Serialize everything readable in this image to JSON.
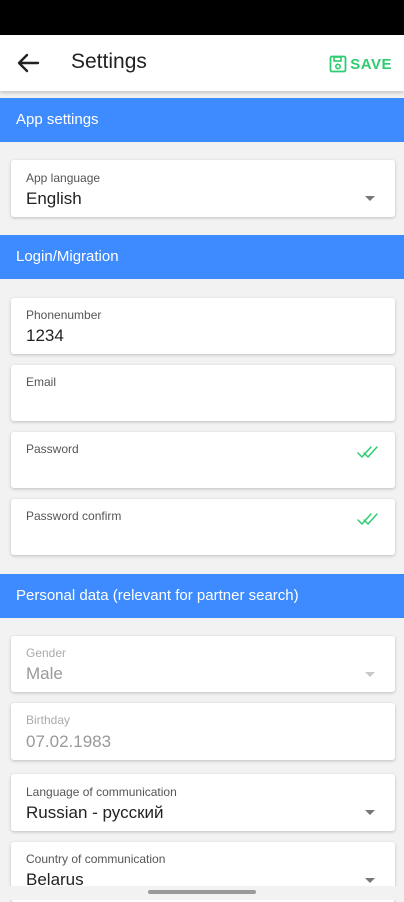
{
  "appbar": {
    "title": "Settings",
    "save_label": "SAVE"
  },
  "sections": {
    "app_settings": "App settings",
    "login": "Login/Migration",
    "personal": "Personal data (relevant for partner search)"
  },
  "fields": {
    "app_language": {
      "label": "App language",
      "value": "English"
    },
    "phone": {
      "label": "Phonenumber",
      "value": "1234"
    },
    "email": {
      "label": "Email",
      "value": ""
    },
    "password": {
      "label": "Password",
      "value": ""
    },
    "password_confirm": {
      "label": "Password confirm",
      "value": ""
    },
    "gender": {
      "label": "Gender",
      "value": "Male"
    },
    "birthday": {
      "label": "Birthday",
      "value": "07.02.1983"
    },
    "comm_language": {
      "label": "Language of communication",
      "value": "Russian - русский"
    },
    "comm_country": {
      "label": "Country of communication",
      "value": "Belarus"
    }
  },
  "colors": {
    "accent": "#3d8bff",
    "save": "#2ecc71"
  },
  "icons": {
    "back": "arrow-back-icon",
    "save": "save-icon",
    "check": "double-check-icon",
    "dropdown": "dropdown-caret-icon"
  }
}
